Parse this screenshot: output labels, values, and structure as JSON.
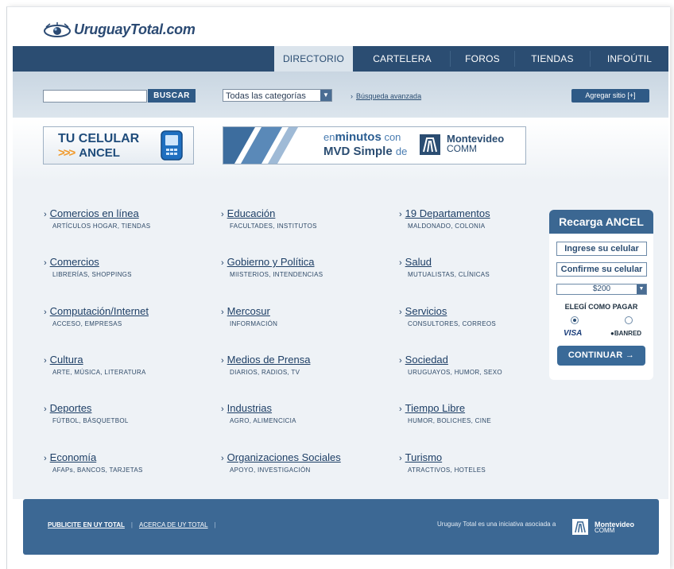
{
  "header": {
    "logo_text": "UruguayTotal.com",
    "nav": [
      "DIRECTORIO",
      "CARTELERA",
      "FOROS",
      "TIENDAS",
      "INFOÚTIL"
    ],
    "active_nav": "DIRECTORIO"
  },
  "search": {
    "query": "",
    "button": "BUSCAR",
    "category": "Todas las categorías",
    "advanced_link": "Búsqueda avanzada",
    "add_site": "Agregar sitio [+]"
  },
  "banners": {
    "ancel": {
      "line1": "TU CELULAR",
      "line2": "ANCEL",
      "arrows": ">>>"
    },
    "mvd": {
      "prefix": "en",
      "highlight": "minutos",
      "suffix": "con",
      "product": "MVD Simple",
      "by": "de",
      "brand": "Montevideo",
      "brand_sub": "COMM"
    }
  },
  "categories": [
    [
      {
        "title": "Comercios en línea",
        "sub": "ARTÍCULOS HOGAR, TIENDAS"
      },
      {
        "title": "Comercios",
        "sub": "LIBRERÍAS, SHOPPINGS"
      },
      {
        "title": "Computación/Internet",
        "sub": "ACCESO, EMPRESAS"
      },
      {
        "title": "Cultura",
        "sub": "ARTE, MÚSICA, LITERATURA"
      },
      {
        "title": "Deportes",
        "sub": "FÚTBOL, BÁSQUETBOL"
      },
      {
        "title": "Economía",
        "sub": "AFAPs, BANCOS, TARJETAS"
      }
    ],
    [
      {
        "title": "Educación",
        "sub": "FACULTADES, INSTITUTOS"
      },
      {
        "title": "Gobierno y Política",
        "sub": "MIISTERIOS, INTENDENCIAS"
      },
      {
        "title": "Mercosur",
        "sub": "INFORMACIÓN"
      },
      {
        "title": "Medios de Prensa",
        "sub": "DIARIOS, RADIOS, TV"
      },
      {
        "title": "Industrias",
        "sub": "AGRO, ALIMENCICIA"
      },
      {
        "title": "Organizaciones Sociales",
        "sub": "APOYO, INVESTIGACIÓN"
      }
    ],
    [
      {
        "title": "19 Departamentos",
        "sub": "MALDONADO, COLONIA"
      },
      {
        "title": "Salud",
        "sub": "MUTUALISTAS, CLÍNICAS"
      },
      {
        "title": "Servicios",
        "sub": "CONSULTORES, CORREOS"
      },
      {
        "title": "Sociedad",
        "sub": "URUGUAYOS, HUMOR, SEXO"
      },
      {
        "title": "Tiempo Libre",
        "sub": "HUMOR, BOLICHES, CINE"
      },
      {
        "title": "Turismo",
        "sub": "ATRACTIVOS, HOTELES"
      }
    ]
  ],
  "recarga": {
    "title": "Recarga ANCEL",
    "field1": "Ingrese su celular",
    "field2": "Confirme su celular",
    "amount": "$200",
    "pay_label": "ELEGÍ COMO PAGAR",
    "visa": "VISA",
    "banred": "BANRED",
    "button": "CONTINUAR",
    "button_arrow": "→"
  },
  "footer": {
    "link1": "PUBLICITE EN UY TOTAL",
    "link2": "ACERCA DE UY TOTAL",
    "sep": "|",
    "tagline": "Uruguay Total es una iniciativa asociada a",
    "brand": "Montevideo",
    "brand_sub": "COMM"
  },
  "colors": {
    "nav_bg": "#2b4d72",
    "nav_active_bg": "#dbe4ec",
    "accent": "#2f5a86",
    "footer_bg": "#3c6894",
    "ancel_arrows": "#f19a2c"
  },
  "icons": [
    "eye-logo-icon",
    "chevron-right-icon",
    "dropdown-arrow-icon",
    "phone-icon",
    "montevideo-comm-logo-icon",
    "arrow-right-icon",
    "banred-icon"
  ]
}
